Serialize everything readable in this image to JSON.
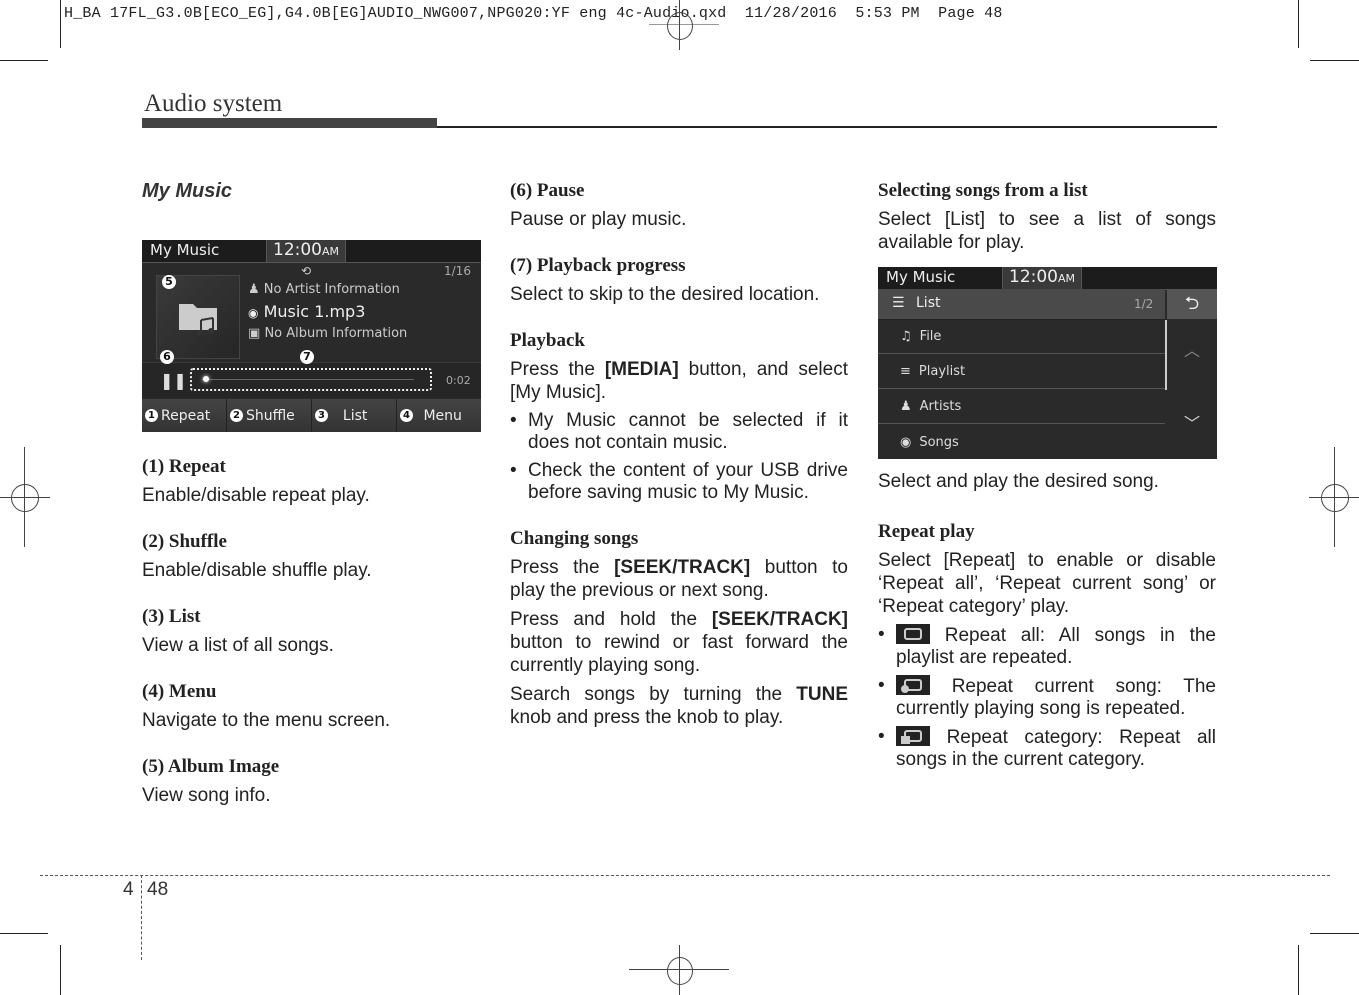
{
  "print_slug": "H_BA 17FL_G3.0B[ECO_EG],G4.0B[EG]AUDIO_NWG007,NPG020:YF eng 4c-Audio.qxd  11/28/2016  5:53 PM  Page 48",
  "running_head": "Audio system",
  "col1": {
    "heading": "My Music",
    "screen": {
      "title": "My Music",
      "clock": "12:00",
      "clock_ampm": "AM",
      "track_index": "1/16",
      "artist": "No Artist Information",
      "song": "Music 1.mp3",
      "album": "No Album Information",
      "elapsed": "0:02",
      "progress_fraction": 0.02,
      "callouts": {
        "album": "5",
        "pause": "6",
        "progress": "7"
      },
      "buttons": [
        {
          "num": "1",
          "label": "Repeat"
        },
        {
          "num": "2",
          "label": "Shuffle"
        },
        {
          "num": "3",
          "label": "List"
        },
        {
          "num": "4",
          "label": "Menu"
        }
      ]
    },
    "sections": [
      {
        "title": "(1) Repeat",
        "text": "Enable/disable repeat play."
      },
      {
        "title": "(2) Shuffle",
        "text": "Enable/disable shuffle play."
      },
      {
        "title": "(3) List",
        "text": "View a list of all songs."
      },
      {
        "title": "(4) Menu",
        "text": "Navigate to the menu screen."
      },
      {
        "title": "(5) Album Image",
        "text": "View song info."
      }
    ]
  },
  "col2": {
    "pause": {
      "title": "(6) Pause",
      "text": "Pause or play music."
    },
    "progress": {
      "title": "(7) Playback progress",
      "text": "Select to skip to the desired location."
    },
    "playback": {
      "title": "Playback",
      "text_pre": "Press the ",
      "text_key": "[MEDIA]",
      "text_post": " button, and select [My Music].",
      "bullets": [
        "My Music cannot be selected if it does not contain music.",
        "Check the content of your USB drive before saving music to My Music."
      ]
    },
    "changing": {
      "title": "Changing songs",
      "p1_pre": "Press the ",
      "p1_key": "[SEEK/TRACK]",
      "p1_post": " button to play the previous or next song.",
      "p2_pre": "Press and hold the ",
      "p2_key": "[SEEK/TRACK]",
      "p2_post": " button to rewind or fast forward the currently playing song.",
      "p3_pre": "Search songs by turning the ",
      "p3_key": "TUNE",
      "p3_post": " knob and press the knob to play."
    }
  },
  "col3": {
    "selecting": {
      "title": "Selecting songs from a list",
      "text": "Select [List] to see a list of songs available for play."
    },
    "screen": {
      "title": "My Music",
      "clock": "12:00",
      "clock_ampm": "AM",
      "list_label": "List",
      "page": "1/2",
      "items": [
        "File",
        "Playlist",
        "Artists",
        "Songs"
      ]
    },
    "after_screen": "Select and play the desired song.",
    "repeat": {
      "title": "Repeat play",
      "text": "Select [Repeat] to enable or disable ‘Repeat all’, ‘Repeat current song’ or ‘Repeat category’ play.",
      "bullets": [
        {
          "icon": "repeat-all-icon",
          "text": "Repeat all: All songs in the playlist are repeated."
        },
        {
          "icon": "repeat-one-icon",
          "text": "Repeat current song: The currently playing song is repeated."
        },
        {
          "icon": "repeat-category-icon",
          "text": "Repeat category: Repeat all songs in the current category."
        }
      ]
    }
  },
  "footer": {
    "chapter": "4",
    "page": "48"
  }
}
